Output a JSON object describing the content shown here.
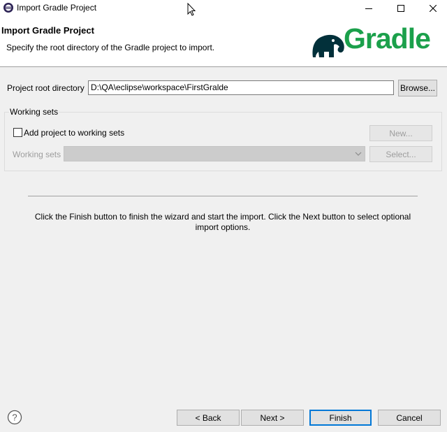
{
  "window": {
    "title": "Import Gradle Project"
  },
  "banner": {
    "title": "Import Gradle Project",
    "description": "Specify the root directory of the Gradle project to import.",
    "logo_text": "Gradle",
    "logo_color": "#1ba04b"
  },
  "root": {
    "label": "Project root directory",
    "value": "D:\\QA\\eclipse\\workspace\\FirstGralde",
    "browse": "Browse..."
  },
  "working_sets": {
    "group_label": "Working sets",
    "checkbox_label": "Add project to working sets",
    "checked": false,
    "new_button": "New...",
    "combo_label": "Working sets",
    "combo_value": "",
    "select_button": "Select..."
  },
  "info": {
    "message": "Click the Finish button to finish the wizard and start the import. Click the Next button to select optional import options."
  },
  "footer": {
    "back": "< Back",
    "next": "Next >",
    "finish": "Finish",
    "cancel": "Cancel"
  }
}
